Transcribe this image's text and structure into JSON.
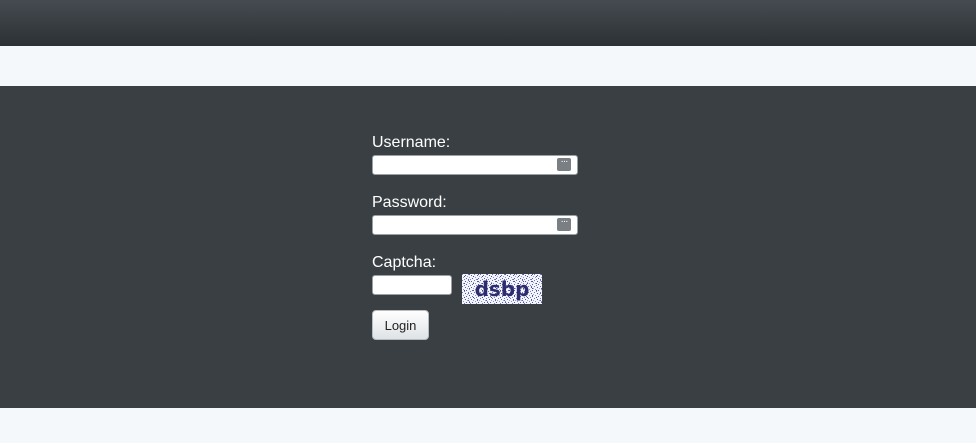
{
  "form": {
    "username_label": "Username:",
    "username_value": "",
    "password_label": "Password:",
    "password_value": "",
    "captcha_label": "Captcha:",
    "captcha_value": "",
    "captcha_text": "dsbp",
    "login_label": "Login"
  },
  "icons": {
    "username_field_icon": "ellipsis-icon",
    "password_field_icon": "ellipsis-icon"
  },
  "colors": {
    "header": "#393f42",
    "panel": "#393f42",
    "background": "#f4f8fb",
    "captcha_text": "#2d2a6e"
  }
}
